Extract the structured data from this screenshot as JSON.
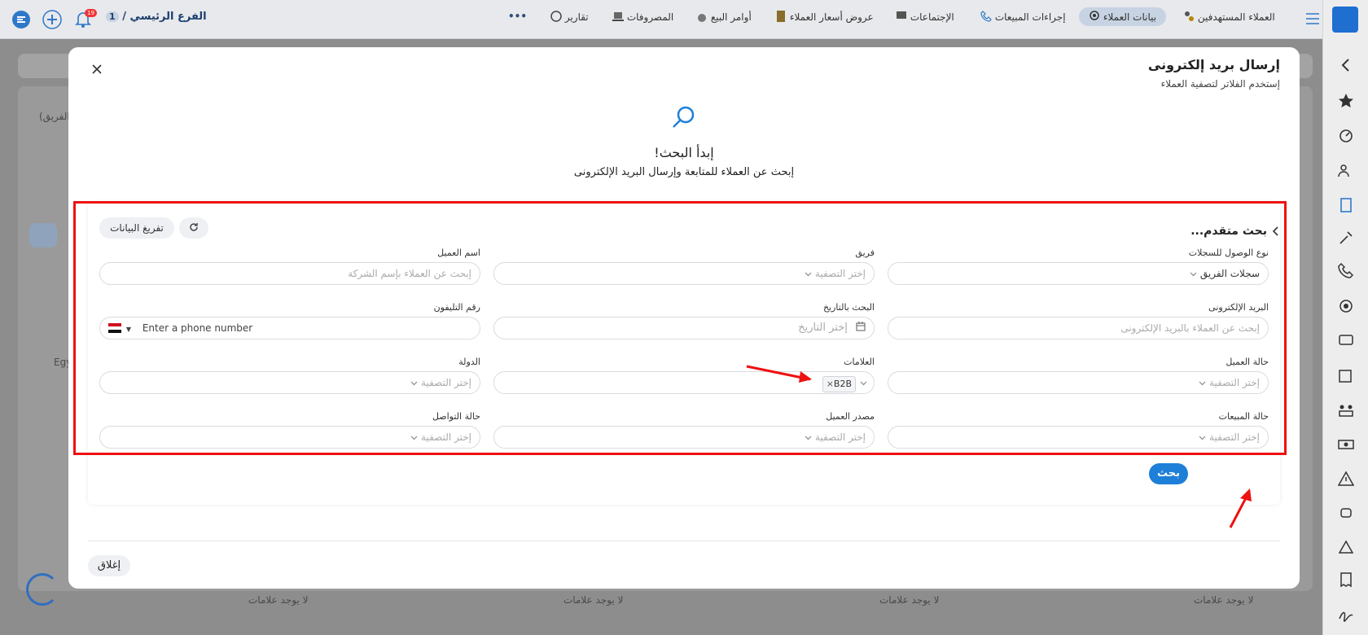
{
  "topbar": {
    "branch_count": "1",
    "branch_label": "الفرع الرئيسي /",
    "notification_count": "19",
    "more": "•••",
    "nav": [
      {
        "label": "العملاء المستهدفين"
      },
      {
        "label": "بيانات العملاء"
      },
      {
        "label": "إجراءات المبيعات"
      },
      {
        "label": "الإجتماعات"
      },
      {
        "label": "عروض أسعار العملاء"
      },
      {
        "label": "أوامر البيع"
      },
      {
        "label": "المصروفات"
      },
      {
        "label": "تقارير"
      }
    ]
  },
  "background": {
    "team_hint": "الفريق)",
    "egy_hint": "Egy",
    "no_tags": "لا يوجد علامات"
  },
  "modal": {
    "title": "إرسال بريد إلكترونى",
    "subtitle": "إستخدم الفلاتر لتصفية العملاء",
    "start_heading": "إبدأ البحث!",
    "start_sub": "إبحث عن العملاء للمتابعة وإرسال البريد الإلكترونى",
    "advanced_title": "بحث متقدم...",
    "clear_label": "تفريغ البيانات",
    "search_label": "بحث",
    "close_label": "إغلاق",
    "fields": {
      "access_type": {
        "label": "نوع الوصول للسجلات",
        "value": "سجلات الفريق"
      },
      "team": {
        "label": "فريق",
        "placeholder": "إختر التصفية"
      },
      "customer_name": {
        "label": "اسم العميل",
        "placeholder": "إبحث عن العملاء بإسم الشركة"
      },
      "email": {
        "label": "البريد الإلكترونى",
        "placeholder": "إبحث عن العملاء بالبريد الإلكترونى"
      },
      "date_search": {
        "label": "البحث بالتاريخ",
        "placeholder": "إختر التاريخ"
      },
      "phone": {
        "label": "رقم التليفون",
        "placeholder": "Enter a phone number"
      },
      "customer_status": {
        "label": "حالة العميل",
        "placeholder": "إختر التصفية"
      },
      "tags": {
        "label": "العلامات",
        "value": "B2B"
      },
      "country": {
        "label": "الدولة",
        "placeholder": "إختر التصفية"
      },
      "sales_status": {
        "label": "حالة المبيعات",
        "placeholder": "إختر التصفية"
      },
      "customer_source": {
        "label": "مصدر العميل",
        "placeholder": "إختر التصفية"
      },
      "contact_status": {
        "label": "حالة التواصل",
        "placeholder": "إختر التصفية"
      }
    }
  },
  "colors": {
    "accent": "#1d7fd8",
    "highlight": "#ee1111"
  }
}
